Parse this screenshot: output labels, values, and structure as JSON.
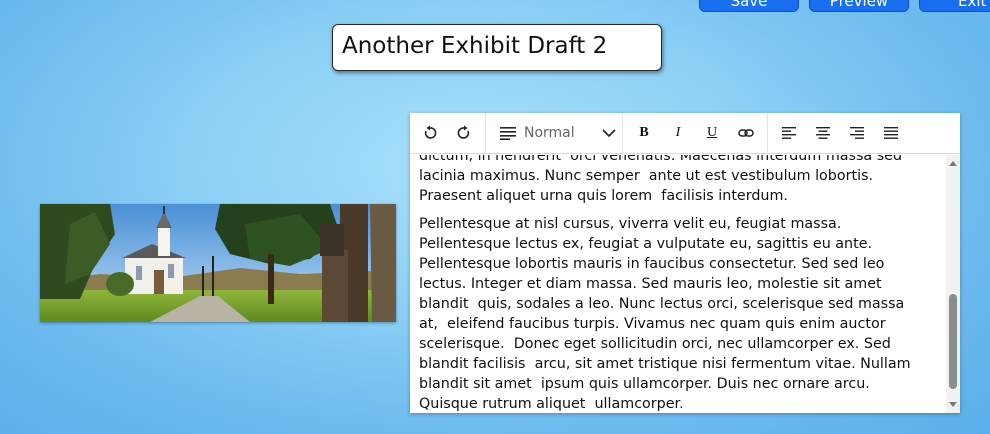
{
  "header": {
    "save_label": "Save",
    "preview_label": "Preview",
    "exit_label": "Exit"
  },
  "exhibit": {
    "title": "Another Exhibit Draft 2"
  },
  "toolbar": {
    "undo": "undo-icon",
    "redo": "redo-icon",
    "block_type": "Normal",
    "bold": "B",
    "italic": "I",
    "underline": "U",
    "link": "link-icon",
    "align_left": "align-left-icon",
    "align_center": "align-center-icon",
    "align_right": "align-right-icon",
    "align_justify": "align-justify-icon"
  },
  "editor": {
    "paragraphs": [
      "dictum, in hendrerit  orci venenatis. Maecenas interdum massa sed\nlacinia maximus. Nunc semper  ante ut est vestibulum lobortis.\nPraesent aliquet urna quis lorem  facilisis interdum.",
      "Pellentesque at nisl cursus, viverra velit eu, feugiat massa.\nPellentesque lectus ex, feugiat a vulputate eu, sagittis eu ante.\nPellentesque lobortis mauris in faucibus consectetur. Sed sed leo\nlectus. Integer et diam massa. Sed mauris leo, molestie sit amet\nblandit  quis, sodales a leo. Nunc lectus orci, scelerisque sed massa\nat,  eleifend faucibus turpis. Vivamus nec quam quis enim auctor\nscelerisque.  Donec eget sollicitudin orci, nec ullamcorper ex. Sed\nblandit facilisis  arcu, sit amet tristique nisi fermentum vitae. Nullam\nblandit sit amet  ipsum quis ullamcorper. Duis nec ornare arcu.\nQuisque rutrum aliquet  ullamcorper."
    ]
  },
  "colors": {
    "accent": "#1a6ff0",
    "background": "#8fd2f6"
  }
}
